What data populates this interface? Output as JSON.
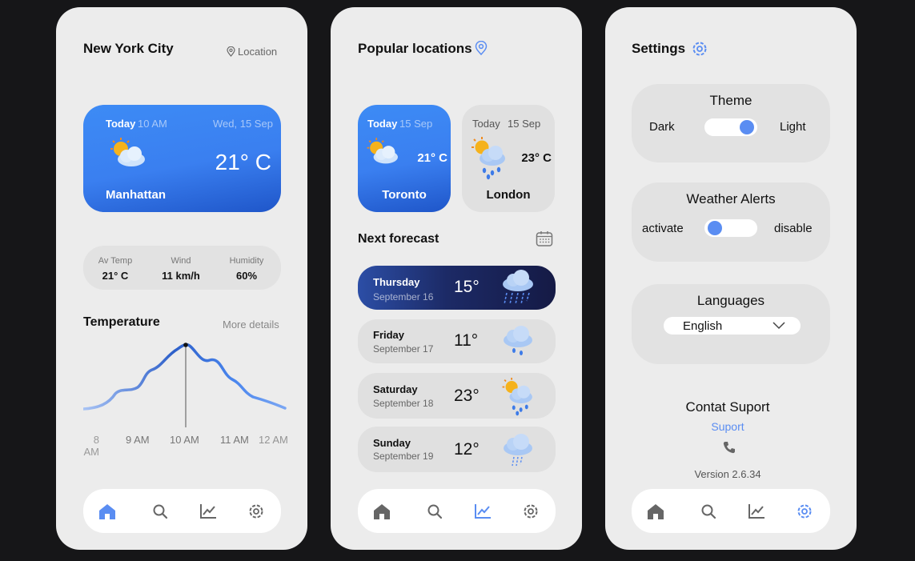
{
  "colors": {
    "accent": "#5a8df2",
    "background": "#161618",
    "panel": "#ececec"
  },
  "screen1": {
    "city": "New York City",
    "location_label": "Location",
    "hero": {
      "today": "Today",
      "time": "10 AM",
      "date": "Wed, 15 Sep",
      "temp": "21° C",
      "place": "Manhattan",
      "icon": "sun-cloud-icon"
    },
    "stats": [
      {
        "label": "Av Temp",
        "value": "21° C"
      },
      {
        "label": "Wind",
        "value": "11 km/h"
      },
      {
        "label": "Humidity",
        "value": "60%"
      }
    ],
    "temperature_title": "Temperature",
    "more_details": "More details",
    "times": [
      "8 AM",
      "9 AM",
      "10 AM",
      "11 AM",
      "12 AM"
    ]
  },
  "screen2": {
    "title": "Popular locations",
    "cards": [
      {
        "today": "Today",
        "date": "15 Sep",
        "temp": "21° C",
        "city": "Toronto",
        "icon": "sun-cloud-icon"
      },
      {
        "today": "Today",
        "date": "15 Sep",
        "temp": "23° C",
        "city": "London",
        "icon": "sun-rain-icon"
      }
    ],
    "next_forecast": "Next forecast",
    "forecast": [
      {
        "day": "Thursday",
        "date": "September 16",
        "temp": "15°",
        "icon": "storm-rain-icon"
      },
      {
        "day": "Friday",
        "date": "September 17",
        "temp": "11°",
        "icon": "rain-cloud-icon"
      },
      {
        "day": "Saturday",
        "date": "September 18",
        "temp": "23°",
        "icon": "sun-rain-icon"
      },
      {
        "day": "Sunday",
        "date": "September 19",
        "temp": "12°",
        "icon": "drizzle-cloud-icon"
      }
    ]
  },
  "screen3": {
    "title": "Settings",
    "theme": {
      "title": "Theme",
      "left": "Dark",
      "right": "Light"
    },
    "alerts": {
      "title": "Weather Alerts",
      "left": "activate",
      "right": "disable"
    },
    "languages": {
      "title": "Languages",
      "selected": "English"
    },
    "support": {
      "title": "Contat Suport",
      "link": "Suport"
    },
    "version": "Version 2.6.34"
  }
}
